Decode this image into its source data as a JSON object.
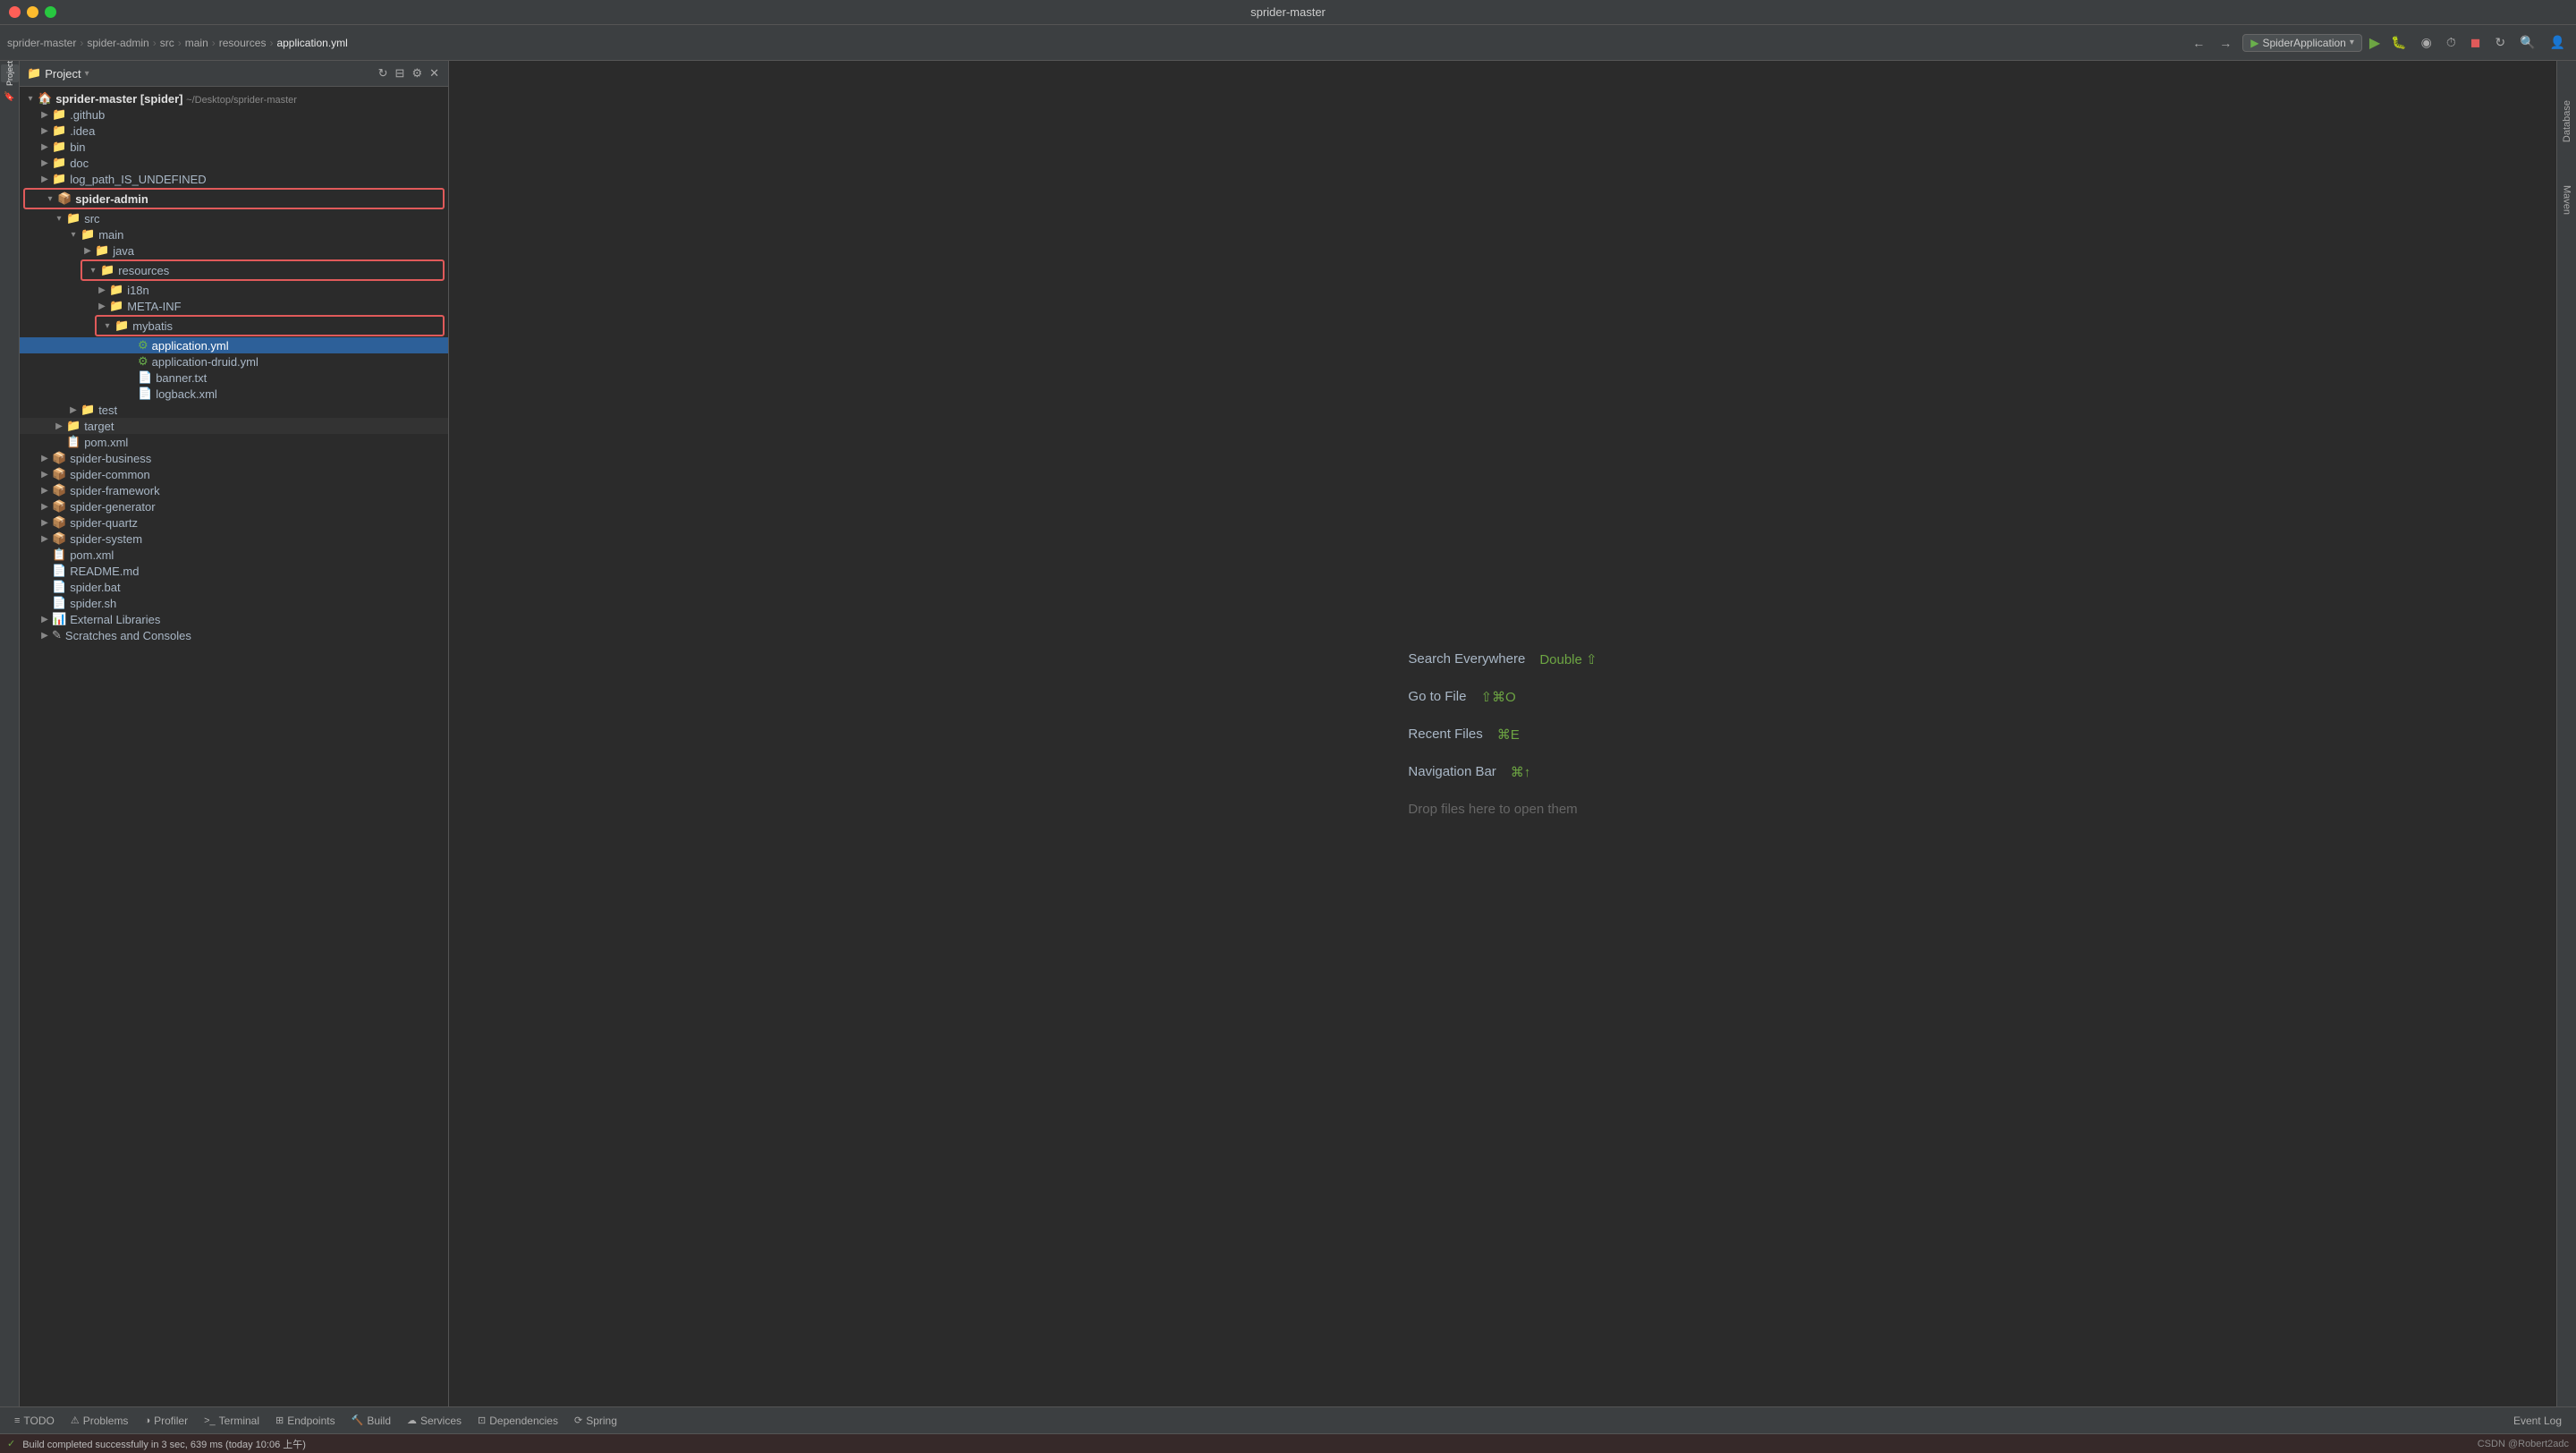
{
  "window": {
    "title": "sprider-master"
  },
  "toolbar": {
    "breadcrumbs": [
      {
        "label": "sprider-master",
        "id": "bc-root"
      },
      {
        "label": "spider-admin",
        "id": "bc-admin"
      },
      {
        "label": "src",
        "id": "bc-src"
      },
      {
        "label": "main",
        "id": "bc-main"
      },
      {
        "label": "resources",
        "id": "bc-resources"
      },
      {
        "label": "application.yml",
        "id": "bc-file"
      }
    ],
    "run_config": "SpiderApplication"
  },
  "sidebar": {
    "title": "Project",
    "root": "sprider-master [spider]",
    "root_path": "~/Desktop/sprider-master"
  },
  "file_tree": [
    {
      "id": "root",
      "label": "sprider-master [spider]",
      "path": "~/Desktop/sprider-master",
      "type": "project",
      "level": 0,
      "expanded": true
    },
    {
      "id": "github",
      "label": ".github",
      "type": "folder",
      "level": 1,
      "expanded": false
    },
    {
      "id": "idea",
      "label": ".idea",
      "type": "folder",
      "level": 1,
      "expanded": false
    },
    {
      "id": "bin",
      "label": "bin",
      "type": "folder",
      "level": 1,
      "expanded": false
    },
    {
      "id": "doc",
      "label": "doc",
      "type": "folder",
      "level": 1,
      "expanded": false
    },
    {
      "id": "log_path",
      "label": "log_path_IS_UNDEFINED",
      "type": "folder",
      "level": 1,
      "expanded": false
    },
    {
      "id": "spider-admin",
      "label": "spider-admin",
      "type": "module",
      "level": 1,
      "expanded": true,
      "highlighted": true
    },
    {
      "id": "src",
      "label": "src",
      "type": "folder",
      "level": 2,
      "expanded": true
    },
    {
      "id": "main",
      "label": "main",
      "type": "folder",
      "level": 3,
      "expanded": true
    },
    {
      "id": "java",
      "label": "java",
      "type": "folder-src",
      "level": 4,
      "expanded": false
    },
    {
      "id": "resources",
      "label": "resources",
      "type": "folder-res",
      "level": 4,
      "expanded": true,
      "highlighted": true
    },
    {
      "id": "i18n",
      "label": "i18n",
      "type": "folder",
      "level": 5,
      "expanded": false
    },
    {
      "id": "META-INF",
      "label": "META-INF",
      "type": "folder",
      "level": 5,
      "expanded": false
    },
    {
      "id": "mybatis",
      "label": "mybatis",
      "type": "folder",
      "level": 5,
      "expanded": true,
      "highlighted": true
    },
    {
      "id": "application.yml",
      "label": "application.yml",
      "type": "file-yml",
      "level": 6,
      "selected": true
    },
    {
      "id": "application-druid.yml",
      "label": "application-druid.yml",
      "type": "file-yml",
      "level": 6
    },
    {
      "id": "banner.txt",
      "label": "banner.txt",
      "type": "file-txt",
      "level": 6
    },
    {
      "id": "logback.xml",
      "label": "logback.xml",
      "type": "file-xml",
      "level": 6
    },
    {
      "id": "test",
      "label": "test",
      "type": "folder",
      "level": 3,
      "expanded": false
    },
    {
      "id": "target",
      "label": "target",
      "type": "folder",
      "level": 2,
      "expanded": false
    },
    {
      "id": "pom-admin",
      "label": "pom.xml",
      "type": "file-pom",
      "level": 2
    },
    {
      "id": "spider-business",
      "label": "spider-business",
      "type": "module",
      "level": 1,
      "expanded": false
    },
    {
      "id": "spider-common",
      "label": "spider-common",
      "type": "module",
      "level": 1,
      "expanded": false
    },
    {
      "id": "spider-framework",
      "label": "spider-framework",
      "type": "module",
      "level": 1,
      "expanded": false
    },
    {
      "id": "spider-generator",
      "label": "spider-generator",
      "type": "module",
      "level": 1,
      "expanded": false
    },
    {
      "id": "spider-quartz",
      "label": "spider-quartz",
      "type": "module",
      "level": 1,
      "expanded": false
    },
    {
      "id": "spider-system",
      "label": "spider-system",
      "type": "module",
      "level": 1,
      "expanded": false
    },
    {
      "id": "pom-root",
      "label": "pom.xml",
      "type": "file-pom",
      "level": 1
    },
    {
      "id": "README",
      "label": "README.md",
      "type": "file-md",
      "level": 1
    },
    {
      "id": "spider.bat",
      "label": "spider.bat",
      "type": "file-bat",
      "level": 1
    },
    {
      "id": "spider.sh",
      "label": "spider.sh",
      "type": "file-sh",
      "level": 1
    },
    {
      "id": "external-libs",
      "label": "External Libraries",
      "type": "ext-libs",
      "level": 1,
      "expanded": false
    },
    {
      "id": "scratches",
      "label": "Scratches and Consoles",
      "type": "scratches",
      "level": 1,
      "expanded": false
    }
  ],
  "editor": {
    "welcome_items": [
      {
        "action": "Search Everywhere",
        "shortcut": "Double ⇧",
        "id": "search-everywhere"
      },
      {
        "action": "Go to File",
        "shortcut": "⇧⌘O",
        "id": "go-to-file"
      },
      {
        "action": "Recent Files",
        "shortcut": "⌘E",
        "id": "recent-files"
      },
      {
        "action": "Navigation Bar",
        "shortcut": "⌘↑",
        "id": "navigation-bar"
      },
      {
        "action": "Drop files here to open them",
        "shortcut": "",
        "id": "drop-files"
      }
    ]
  },
  "bottom_tabs": [
    {
      "id": "todo",
      "label": "TODO",
      "icon": "≡"
    },
    {
      "id": "problems",
      "label": "Problems",
      "icon": "⚠"
    },
    {
      "id": "profiler",
      "label": "Profiler",
      "icon": "◑"
    },
    {
      "id": "terminal",
      "label": "Terminal",
      "icon": ">_"
    },
    {
      "id": "endpoints",
      "label": "Endpoints",
      "icon": "⊞"
    },
    {
      "id": "build",
      "label": "Build",
      "icon": "🔨"
    },
    {
      "id": "services",
      "label": "Services",
      "icon": "☁"
    },
    {
      "id": "dependencies",
      "label": "Dependencies",
      "icon": "⊡"
    },
    {
      "id": "spring",
      "label": "Spring",
      "icon": "⟳"
    }
  ],
  "bottom_right": {
    "event_log": "Event Log"
  },
  "status_bar": {
    "message": "Build completed successfully in 3 sec, 639 ms (today 10:06 上午)",
    "right_text": "CSDN @Robert2adc"
  },
  "right_panel": {
    "database": "Database",
    "maven": "Maven"
  }
}
